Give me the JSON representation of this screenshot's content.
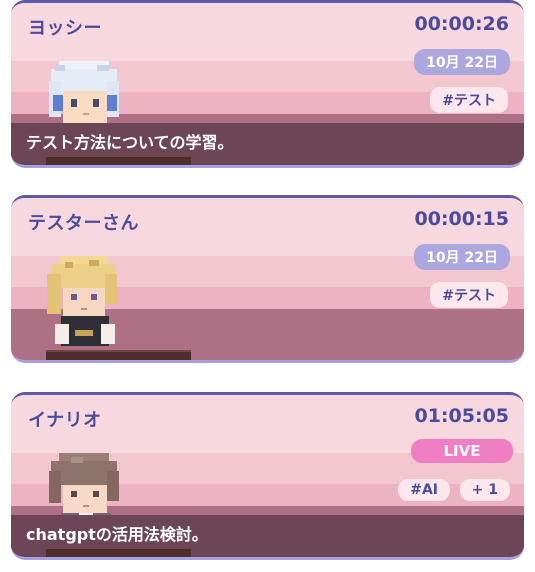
{
  "cards": [
    {
      "user": "ヨッシー",
      "timer": "00:00:26",
      "date": "10月 22日",
      "tags": [
        "#テスト"
      ],
      "caption": "テスト方法についての学習。",
      "avatar_icon": "pixel-avatar-white-hair"
    },
    {
      "user": "テスターさん",
      "timer": "00:00:15",
      "date": "10月 22日",
      "tags": [
        "#テスト"
      ],
      "caption": "",
      "avatar_icon": "pixel-avatar-blonde-hair"
    },
    {
      "user": "イナリオ",
      "timer": "01:05:05",
      "status": "LIVE",
      "tags": [
        "#AI"
      ],
      "more_tags": "+ 1",
      "caption": "chatgptの活用法検討。",
      "avatar_icon": "pixel-avatar-brown-hair"
    }
  ],
  "colors": {
    "text": "#4b4a9d",
    "live": "#f07ec3",
    "date_pill": "#aca7df",
    "caption_bar": "#6c4656"
  }
}
